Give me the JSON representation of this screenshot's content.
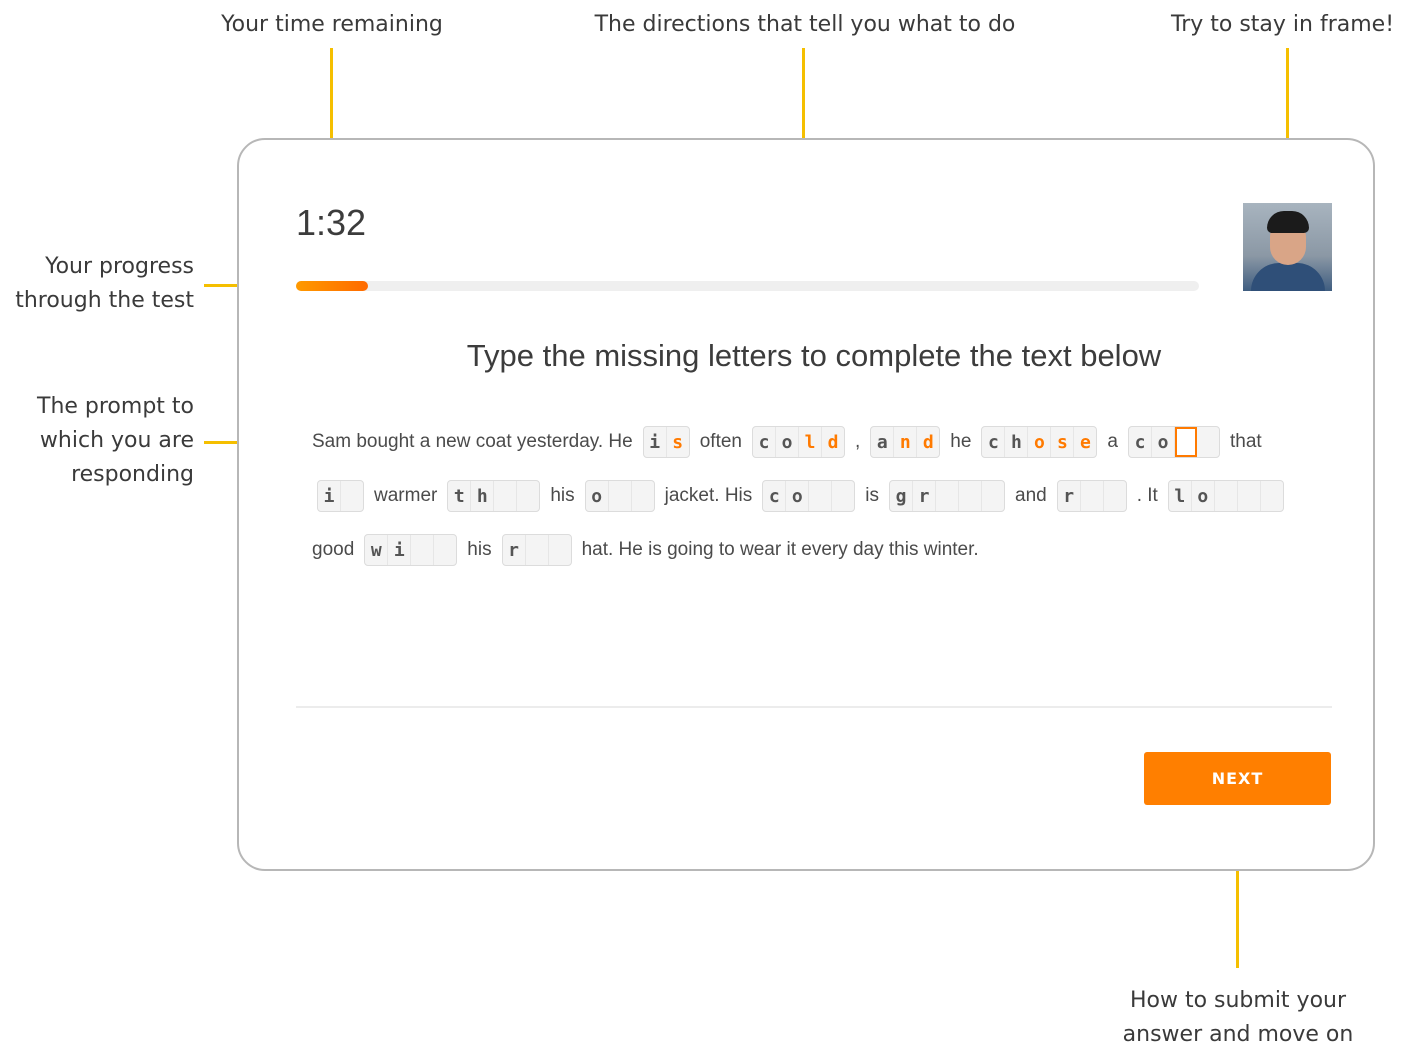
{
  "annotations": {
    "time": "Your time remaining",
    "directions": "The directions that tell you what to do",
    "frame": "Try to stay in frame!",
    "progress_1": "Your progress",
    "progress_2": "through the test",
    "prompt_1": "The prompt to",
    "prompt_2": "which you are",
    "prompt_3": "responding",
    "submit_1": "How to submit your",
    "submit_2": "answer and move on"
  },
  "test": {
    "timer": "1:32",
    "progress_fraction": 0.08,
    "directions": "Type the missing letters to complete the text below",
    "next_label": "NEXT"
  },
  "prompt": {
    "lines": [
      [
        {
          "t": "Sam bought a new coat yesterday. He"
        },
        {
          "b": [
            [
              "i",
              "g"
            ],
            [
              "s",
              "t"
            ]
          ]
        },
        {
          "t": "often"
        },
        {
          "b": [
            [
              "c",
              "g"
            ],
            [
              "o",
              "g"
            ],
            [
              "l",
              "t"
            ],
            [
              "d",
              "t"
            ]
          ]
        },
        {
          "t": ","
        },
        {
          "b": [
            [
              "a",
              "g"
            ],
            [
              "n",
              "t"
            ],
            [
              "d",
              "t"
            ]
          ]
        },
        {
          "t": "he"
        },
        {
          "b": [
            [
              "c",
              "g"
            ],
            [
              "h",
              "g"
            ],
            [
              "o",
              "t"
            ],
            [
              "s",
              "t"
            ],
            [
              "e",
              "t"
            ]
          ]
        },
        {
          "t": "a"
        },
        {
          "b": [
            [
              "c",
              "g"
            ],
            [
              "o",
              "g"
            ],
            [
              "",
              "c"
            ],
            [
              "",
              "e"
            ]
          ]
        },
        {
          "t": "that"
        }
      ],
      [
        {
          "b": [
            [
              "i",
              "g"
            ],
            [
              "",
              "e"
            ]
          ]
        },
        {
          "t": "warmer"
        },
        {
          "b": [
            [
              "t",
              "g"
            ],
            [
              "h",
              "g"
            ],
            [
              "",
              "e"
            ],
            [
              "",
              "e"
            ]
          ]
        },
        {
          "t": "his"
        },
        {
          "b": [
            [
              "o",
              "g"
            ],
            [
              "",
              "e"
            ],
            [
              "",
              "e"
            ]
          ]
        },
        {
          "t": "jacket.  His"
        },
        {
          "b": [
            [
              "c",
              "g"
            ],
            [
              "o",
              "g"
            ],
            [
              "",
              "e"
            ],
            [
              "",
              "e"
            ]
          ]
        },
        {
          "t": "is"
        },
        {
          "b": [
            [
              "g",
              "g"
            ],
            [
              "r",
              "g"
            ],
            [
              "",
              "e"
            ],
            [
              "",
              "e"
            ],
            [
              "",
              "e"
            ]
          ]
        },
        {
          "t": "and"
        },
        {
          "b": [
            [
              "r",
              "g"
            ],
            [
              "",
              "e"
            ],
            [
              "",
              "e"
            ]
          ]
        },
        {
          "t": ". It"
        },
        {
          "b": [
            [
              "l",
              "g"
            ],
            [
              "o",
              "g"
            ],
            [
              "",
              "e"
            ],
            [
              "",
              "e"
            ],
            [
              "",
              "e"
            ]
          ]
        }
      ],
      [
        {
          "t": "good"
        },
        {
          "b": [
            [
              "w",
              "g"
            ],
            [
              "i",
              "g"
            ],
            [
              "",
              "e"
            ],
            [
              "",
              "e"
            ]
          ]
        },
        {
          "t": "his"
        },
        {
          "b": [
            [
              "r",
              "g"
            ],
            [
              "",
              "e"
            ],
            [
              "",
              "e"
            ]
          ]
        },
        {
          "t": "hat. He is going to wear it every day this winter."
        }
      ]
    ]
  }
}
